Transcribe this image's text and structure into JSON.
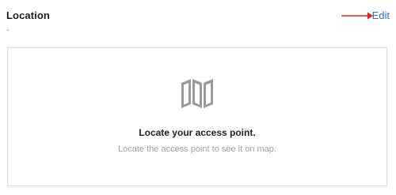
{
  "location": {
    "title": "Location",
    "value": "-",
    "edit_label": "Edit"
  },
  "map_empty": {
    "icon": "map-icon",
    "title": "Locate your access point.",
    "description": "Locate the access point to see it on map."
  },
  "colors": {
    "link": "#2f6fd6",
    "annotation_arrow": "#e02424",
    "icon": "#9a9a9a",
    "border": "#dcdcdc"
  }
}
